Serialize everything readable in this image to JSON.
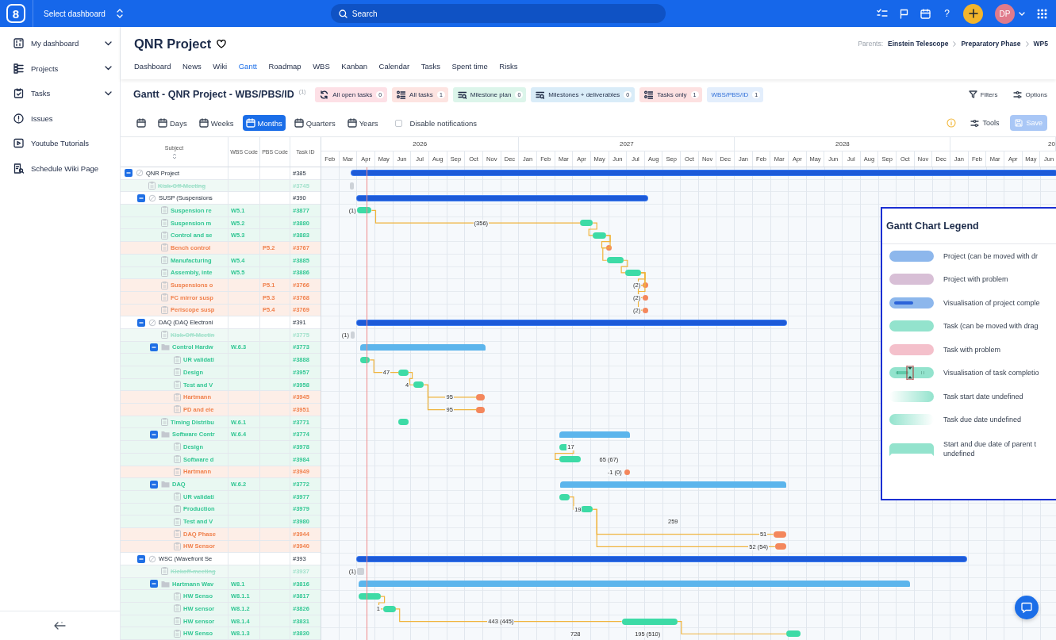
{
  "topbar": {
    "logo": "8",
    "dashboard": "Select dashboard",
    "search_placeholder": "Search",
    "help": "?",
    "avatar": "DP"
  },
  "sidebar": {
    "items": [
      {
        "label": "My dashboard",
        "kind": "dashboard",
        "expandable": true
      },
      {
        "label": "Projects",
        "kind": "projects",
        "expandable": true
      },
      {
        "label": "Tasks",
        "kind": "tasks",
        "expandable": true
      },
      {
        "label": "Issues",
        "kind": "issues",
        "expandable": false
      },
      {
        "label": "Youtube Tutorials",
        "kind": "video",
        "expandable": false
      },
      {
        "label": "Schedule Wiki Page",
        "kind": "wiki",
        "expandable": false
      }
    ]
  },
  "project": {
    "title": "QNR Project",
    "parents_label": "Parents:",
    "parents": [
      "Einstein Telescope",
      "Preparatory Phase",
      "WP5"
    ],
    "tabs": [
      {
        "label": "Dashboard",
        "selected": false
      },
      {
        "label": "News",
        "selected": false
      },
      {
        "label": "Wiki",
        "selected": false
      },
      {
        "label": "Gantt",
        "selected": true
      },
      {
        "label": "Roadmap",
        "selected": false
      },
      {
        "label": "WBS",
        "selected": false
      },
      {
        "label": "Kanban",
        "selected": false
      },
      {
        "label": "Calendar",
        "selected": false
      },
      {
        "label": "Tasks",
        "selected": false
      },
      {
        "label": "Spent time",
        "selected": false
      },
      {
        "label": "Risks",
        "selected": false
      }
    ]
  },
  "gantt_toolbar": {
    "title": "Gantt - QNR Project - WBS/PBS/ID",
    "title_count": "(1)",
    "chips": [
      {
        "label": "All open tasks",
        "count": "0",
        "kind": "refresh",
        "color": "#fde0e6",
        "selected": false
      },
      {
        "label": "All tasks",
        "count": "1",
        "kind": "list",
        "color": "#fde4e1",
        "selected": false
      },
      {
        "label": "Milestone plan",
        "count": "0",
        "kind": "milestone",
        "color": "#dcf5ea",
        "selected": false
      },
      {
        "label": "Milestones + deliverables",
        "count": "0",
        "kind": "milestone",
        "color": "#d9ecf8",
        "selected": false
      },
      {
        "label": "Tasks only",
        "count": "1",
        "kind": "list",
        "color": "#fde1e1",
        "selected": false
      },
      {
        "label": "WBS/PBS/ID",
        "count": "1",
        "kind": "plain",
        "color": "#e3eefc",
        "selected": true
      }
    ],
    "filters": "Filters",
    "options": "Options",
    "zoom": [
      {
        "label": "Days",
        "selected": false
      },
      {
        "label": "Weeks",
        "selected": false
      },
      {
        "label": "Months",
        "selected": true
      },
      {
        "label": "Quarters",
        "selected": false
      },
      {
        "label": "Years",
        "selected": false
      }
    ],
    "notifications": {
      "label": "Disable notifications",
      "checked": false
    },
    "tools": "Tools",
    "save": {
      "label": "Save",
      "disabled": true
    }
  },
  "gantt": {
    "columns": [
      "Subject",
      "WBS Code",
      "PBS Code",
      "Task ID"
    ],
    "years": [
      {
        "label": "2026",
        "months": [
          "Feb",
          "Mar",
          "Apr",
          "May",
          "Jun",
          "Jul",
          "Aug",
          "Sep",
          "Oct",
          "Nov",
          "Dec"
        ]
      },
      {
        "label": "2027",
        "months": [
          "Jan",
          "Feb",
          "Mar",
          "Apr",
          "May",
          "Jun",
          "Jul",
          "Aug",
          "Sep",
          "Oct",
          "Nov",
          "Dec"
        ]
      },
      {
        "label": "2028",
        "months": [
          "Jan",
          "Feb",
          "Mar",
          "Apr",
          "May",
          "Jun",
          "Jul",
          "Aug",
          "Sep",
          "Oct",
          "Nov",
          "Dec"
        ]
      },
      {
        "label": "20",
        "months": [
          "Jan",
          "Feb",
          "Mar",
          "Apr",
          "May",
          "Jun"
        ]
      }
    ],
    "rows": [
      {
        "subject": "QNR Project",
        "task_id": "#385",
        "kind": "project",
        "expanded": true,
        "children": [
          {
            "subject": "Kisk-Off-Meeting",
            "task_id": "#3745",
            "kind": "closed"
          },
          {
            "subject": "SUSP (Suspensions",
            "task_id": "#390",
            "kind": "project",
            "expanded": true,
            "children": [
              {
                "subject": "Suspension re",
                "wbs": "W5.1",
                "task_id": "#3877",
                "kind": "task"
              },
              {
                "subject": "Suspension m",
                "wbs": "W5.2",
                "task_id": "#3880",
                "kind": "task"
              },
              {
                "subject": "Control and se",
                "wbs": "W5.3",
                "task_id": "#3883",
                "kind": "task"
              },
              {
                "subject": "Bench control",
                "pbs": "P5.2",
                "task_id": "#3767",
                "kind": "problem"
              },
              {
                "subject": "Manufacturing",
                "wbs": "W5.4",
                "task_id": "#3885",
                "kind": "task"
              },
              {
                "subject": "Assembly, inte",
                "wbs": "W5.5",
                "task_id": "#3886",
                "kind": "task"
              },
              {
                "subject": "Suspensions o",
                "pbs": "P5.1",
                "task_id": "#3766",
                "kind": "problem"
              },
              {
                "subject": "FC mirror susp",
                "pbs": "P5.3",
                "task_id": "#3768",
                "kind": "problem"
              },
              {
                "subject": "Periscope susp",
                "pbs": "P5.4",
                "task_id": "#3769",
                "kind": "problem"
              }
            ]
          },
          {
            "subject": "DAQ (DAQ Electroni",
            "task_id": "#391",
            "kind": "project",
            "expanded": true,
            "children": [
              {
                "subject": "Kisk-Off-Meetin",
                "task_id": "#3775",
                "kind": "closed"
              },
              {
                "subject": "Control Hardw",
                "wbs": "W.6.3",
                "task_id": "#3773",
                "kind": "group",
                "expanded": true,
                "children": [
                  {
                    "subject": "UR validati",
                    "task_id": "#3888",
                    "kind": "task"
                  },
                  {
                    "subject": "Design",
                    "task_id": "#3957",
                    "kind": "task"
                  },
                  {
                    "subject": "Test and V",
                    "task_id": "#3958",
                    "kind": "task"
                  },
                  {
                    "subject": "Hartmann",
                    "task_id": "#3945",
                    "kind": "problem"
                  },
                  {
                    "subject": "PD and ele",
                    "task_id": "#3951",
                    "kind": "problem"
                  }
                ]
              },
              {
                "subject": "Timing Distribu",
                "wbs": "W.6.1",
                "task_id": "#3771",
                "kind": "task"
              },
              {
                "subject": "Software Contr",
                "wbs": "W.6.4",
                "task_id": "#3774",
                "kind": "group",
                "expanded": true,
                "children": [
                  {
                    "subject": "Design",
                    "task_id": "#3978",
                    "kind": "task"
                  },
                  {
                    "subject": "Software d",
                    "task_id": "#3984",
                    "kind": "task"
                  },
                  {
                    "subject": "Hartmann",
                    "task_id": "#3949",
                    "kind": "problem"
                  }
                ]
              },
              {
                "subject": "DAQ",
                "wbs": "W.6.2",
                "task_id": "#3772",
                "kind": "group",
                "expanded": true,
                "children": [
                  {
                    "subject": "UR validati",
                    "task_id": "#3977",
                    "kind": "task"
                  },
                  {
                    "subject": "Production",
                    "task_id": "#3979",
                    "kind": "task"
                  },
                  {
                    "subject": "Test and V",
                    "task_id": "#3980",
                    "kind": "task"
                  },
                  {
                    "subject": "DAQ Phase",
                    "task_id": "#3944",
                    "kind": "problem"
                  },
                  {
                    "subject": "HW Sensor",
                    "task_id": "#3940",
                    "kind": "problem"
                  }
                ]
              }
            ]
          },
          {
            "subject": "WSC (Wavefront Se",
            "task_id": "#393",
            "kind": "project",
            "expanded": true,
            "children": [
              {
                "subject": "Kickoff-meeting",
                "task_id": "#3937",
                "kind": "closed"
              },
              {
                "subject": "Hartmann Wav",
                "wbs": "W8.1",
                "task_id": "#3816",
                "kind": "group",
                "expanded": true,
                "children": [
                  {
                    "subject": "HW Senso",
                    "wbs": "W8.1.1",
                    "task_id": "#3817",
                    "kind": "task"
                  },
                  {
                    "subject": "HW sensor",
                    "wbs": "W8.1.2",
                    "task_id": "#3826",
                    "kind": "task"
                  },
                  {
                    "subject": "HW sensor",
                    "wbs": "W8.1.4",
                    "task_id": "#3831",
                    "kind": "task"
                  },
                  {
                    "subject": "HW Senso",
                    "wbs": "W8.1.3",
                    "task_id": "#3830",
                    "kind": "task"
                  }
                ]
              }
            ]
          }
        ]
      }
    ],
    "lag_labels": [
      {
        "text": "(1)"
      },
      {
        "text": "(356)"
      },
      {
        "text": "(2)"
      },
      {
        "text": "(2)"
      },
      {
        "text": "(2)"
      },
      {
        "text": "(1)"
      },
      {
        "text": "47"
      },
      {
        "text": "4"
      },
      {
        "text": "95"
      },
      {
        "text": "95"
      },
      {
        "text": "17"
      },
      {
        "text": "65 (67)"
      },
      {
        "text": "-1 (0)"
      },
      {
        "text": "19"
      },
      {
        "text": "259"
      },
      {
        "text": "51"
      },
      {
        "text": "52 (54)"
      },
      {
        "text": "(1)"
      },
      {
        "text": "1"
      },
      {
        "text": "443 (445)"
      },
      {
        "text": "728"
      },
      {
        "text": "195 (510)"
      }
    ]
  },
  "legend": {
    "title": "Gantt Chart Legend",
    "items": [
      {
        "kind": "project",
        "label": "Project (can be moved with dr"
      },
      {
        "kind": "project_problem",
        "label": "Project with problem"
      },
      {
        "kind": "project_progress",
        "label": "Visualisation of project comple"
      },
      {
        "kind": "task",
        "label": "Task (can be moved with drag"
      },
      {
        "kind": "task_problem",
        "label": "Task with problem"
      },
      {
        "kind": "task_progress",
        "label": "Visualisation of task completio"
      },
      {
        "kind": "start_undefined",
        "label": "Task start date undefined"
      },
      {
        "kind": "due_undefined",
        "label": "Task due date undefined"
      },
      {
        "kind": "parent_undefined",
        "label": "Start and due date of parent t undefined"
      }
    ]
  }
}
